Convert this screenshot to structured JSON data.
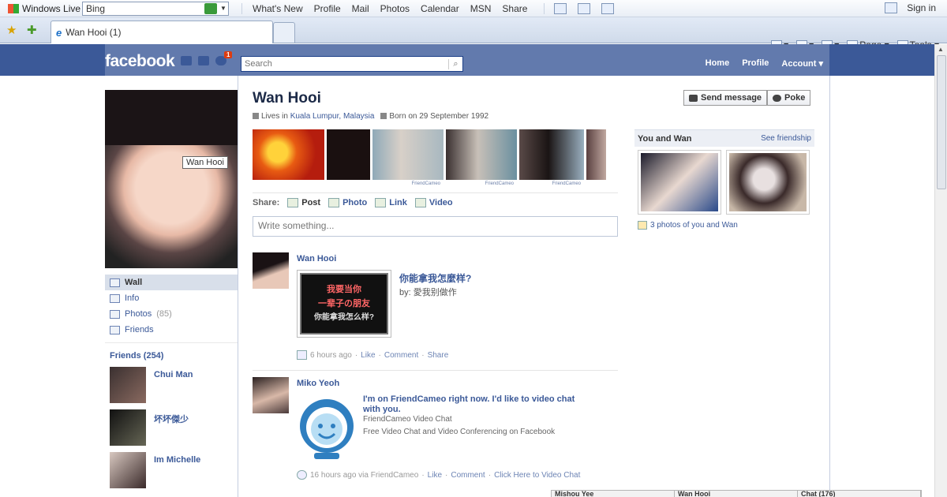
{
  "browser": {
    "toolbar_brand": "Windows Live",
    "search_value": "Bing",
    "links": [
      "What's New",
      "Profile",
      "Mail",
      "Photos",
      "Calendar",
      "MSN",
      "Share"
    ],
    "sign_in": "Sign in",
    "tab_title": "Wan Hooi (1)",
    "cmd": {
      "page": "Page",
      "tools": "Tools"
    }
  },
  "fb": {
    "logo": "facebook",
    "notif_count": "1",
    "search_placeholder": "Search",
    "nav": [
      "Home",
      "Profile",
      "Account"
    ],
    "accent": "#3b5998"
  },
  "profile": {
    "name": "Wan Hooi",
    "pic_tooltip": "Wan Hooi",
    "lives_prefix": "Lives in",
    "lives_place": "Kuala Lumpur, Malaysia",
    "born": "Born on 29 September 1992",
    "send_message": "Send message",
    "poke": "Poke",
    "watermark": "FriendCameo"
  },
  "left_nav": [
    {
      "label": "Wall",
      "count": ""
    },
    {
      "label": "Info",
      "count": ""
    },
    {
      "label": "Photos",
      "count": "(85)"
    },
    {
      "label": "Friends",
      "count": ""
    }
  ],
  "friends": {
    "header": "Friends (254)",
    "items": [
      "Chui Man",
      "坏坏傑少",
      "Im Michelle"
    ]
  },
  "share": {
    "label": "Share:",
    "options": [
      "Post",
      "Photo",
      "Link",
      "Video"
    ],
    "placeholder": "Write something..."
  },
  "stories": [
    {
      "author": "Wan Hooi",
      "title": "你能拿我怎麼样?",
      "by_prefix": "by:",
      "by": "愛我别做作",
      "image_text": [
        "我要当你",
        "一辈子の朋友",
        "你能拿我怎么样?"
      ],
      "time": "6 hours ago",
      "actions": [
        "Like",
        "Comment",
        "Share"
      ]
    },
    {
      "author": "Miko Yeoh",
      "title": "I'm on FriendCameo right now. I'd like to video chat with you.",
      "sub1": "FriendCameo Video Chat",
      "sub2": "Free Video Chat and Video Conferencing on Facebook",
      "time": "16 hours ago via FriendCameo",
      "actions": [
        "Like",
        "Comment",
        "Click Here to Video Chat"
      ]
    }
  ],
  "sidebar": {
    "title": "You and Wan",
    "link": "See friendship",
    "caption": "3 photos of you and Wan"
  },
  "chat": [
    "Mishou Yee",
    "Wan Hooi",
    "Chat (176)"
  ]
}
